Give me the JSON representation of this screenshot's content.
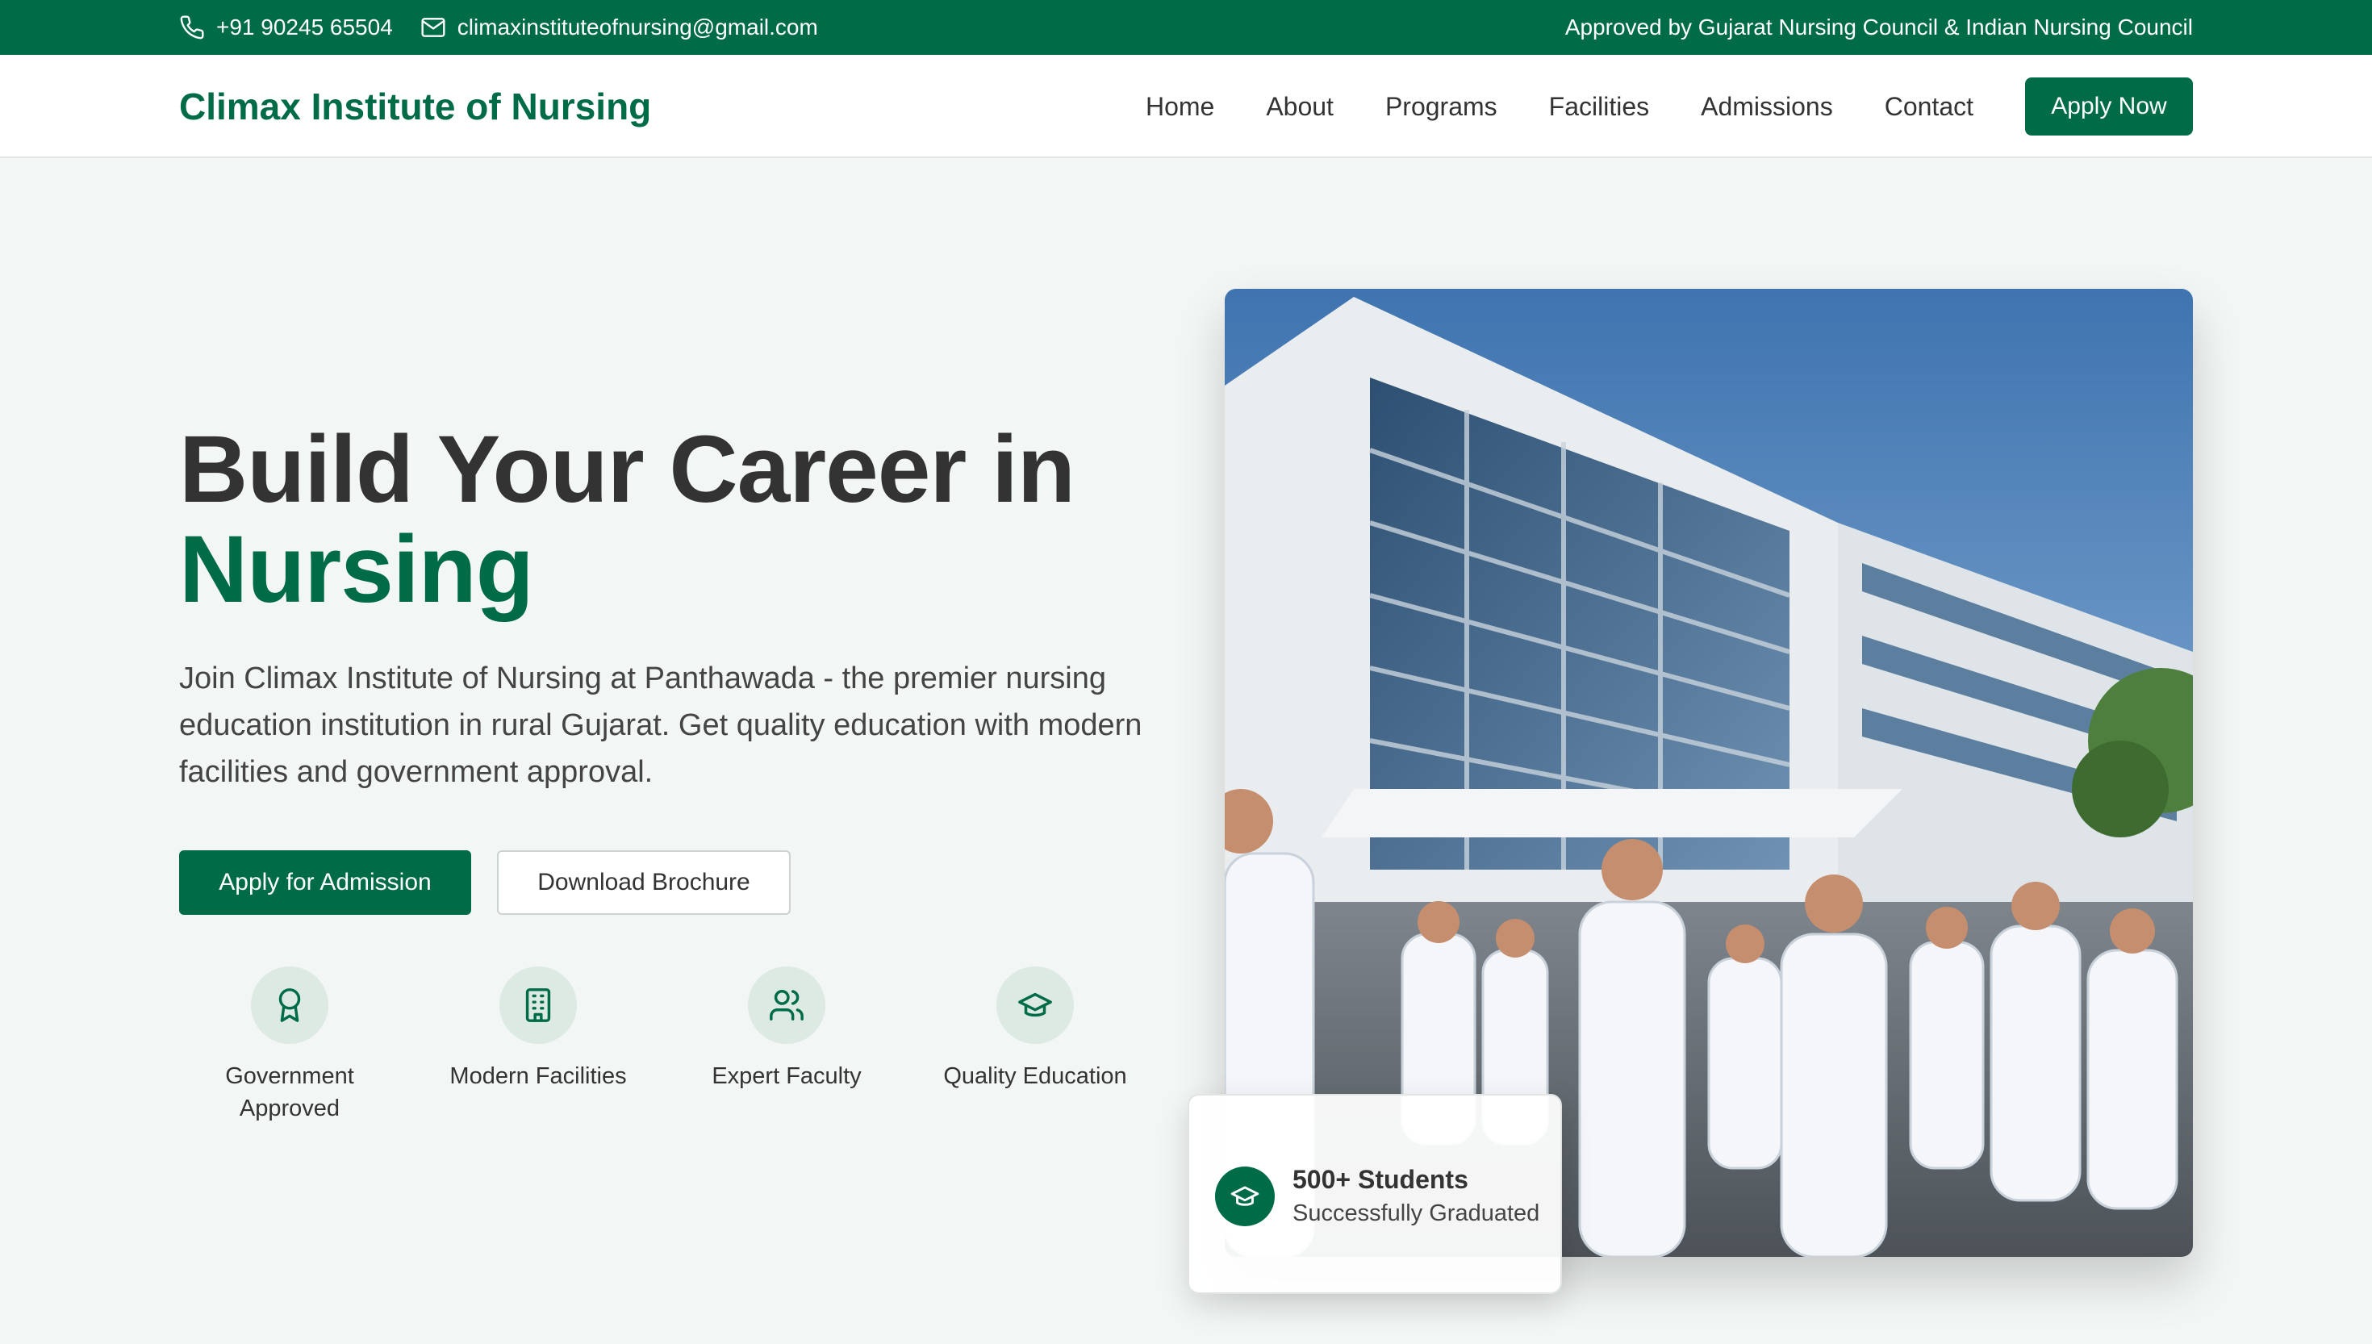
{
  "topbar": {
    "phone": "+91 90245 65504",
    "email": "climaxinstituteofnursing@gmail.com",
    "approval": "Approved by Gujarat Nursing Council & Indian Nursing Council"
  },
  "nav": {
    "logo": "Climax Institute of Nursing",
    "links": [
      "Home",
      "About",
      "Programs",
      "Facilities",
      "Admissions",
      "Contact"
    ],
    "cta": "Apply Now"
  },
  "hero": {
    "title_line1": "Build Your Career in",
    "title_line2": "Nursing",
    "description": "Join Climax Institute of Nursing at Panthawada - the premier nursing education institution in rural Gujarat. Get quality education with modern facilities and government approval.",
    "primary_button": "Apply for Admission",
    "secondary_button": "Download Brochure"
  },
  "features": [
    {
      "label": "Government Approved",
      "icon": "award-icon"
    },
    {
      "label": "Modern Facilities",
      "icon": "building-icon"
    },
    {
      "label": "Expert Faculty",
      "icon": "users-icon"
    },
    {
      "label": "Quality Education",
      "icon": "graduation-cap-icon"
    }
  ],
  "stats": {
    "title": "500+ Students",
    "subtitle": "Successfully Graduated"
  },
  "colors": {
    "brand": "#006b47",
    "text": "#333333",
    "background": "#f2f6f4"
  }
}
